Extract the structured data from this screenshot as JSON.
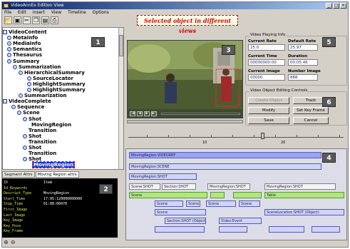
{
  "window": {
    "title": "VideoAnnEx Edition View",
    "controls": [
      "_",
      "□",
      "×"
    ]
  },
  "menu": [
    "File",
    "Edit",
    "Insert",
    "View",
    "Timeline",
    "Options"
  ],
  "toolbar": [
    "open-icon",
    "save-icon",
    "cut-icon",
    "copy-icon",
    "paste-icon",
    "print-icon"
  ],
  "banner": "Selected object in different views",
  "tree": [
    {
      "label": "VideoContent",
      "icon": "folder"
    },
    {
      "label": "MetaInfo",
      "icon": "node"
    },
    {
      "label": "MediaInfo",
      "icon": "node"
    },
    {
      "label": "Semantics",
      "icon": "node"
    },
    {
      "label": "Thesaurus",
      "icon": "node"
    },
    {
      "label": "Summary",
      "icon": "node"
    },
    {
      "label": "Summarization",
      "icon": "node"
    },
    {
      "label": "HierarchicalSummary",
      "icon": "node"
    },
    {
      "label": "SourceLocator",
      "icon": "node"
    },
    {
      "label": "HighlightSummary",
      "icon": "node"
    },
    {
      "label": "HighlightSummary",
      "icon": "node"
    },
    {
      "label": "Summarization",
      "icon": "node"
    },
    {
      "label": "VideoComplete",
      "icon": "folder"
    },
    {
      "label": "Sequence",
      "icon": "node"
    },
    {
      "label": "Scene",
      "icon": "node"
    },
    {
      "label": "Shot",
      "icon": "node"
    },
    {
      "label": "MovingRegion",
      "icon": "none"
    },
    {
      "label": "Transition",
      "icon": "none"
    },
    {
      "label": "Shot",
      "icon": "node"
    },
    {
      "label": "Transition",
      "icon": "none"
    },
    {
      "label": "Shot",
      "icon": "node"
    },
    {
      "label": "Transition",
      "icon": "none"
    },
    {
      "label": "Shot",
      "icon": "node"
    },
    {
      "label": "MovingRegion",
      "icon": "none",
      "selected": true
    }
  ],
  "tabs": [
    "Segment Attrs",
    "Moving Region attrs"
  ],
  "properties": [
    {
      "key": "ID",
      "value": "Item"
    },
    {
      "key": "Id_Keywords",
      "value": ""
    },
    {
      "key": "Descript_Type",
      "value": "MovingRegion"
    },
    {
      "key": "Start_Time",
      "value": "17:05:120000000000"
    },
    {
      "key": "Stop_Time",
      "value": "01:08:00470"
    },
    {
      "key": "First_Image",
      "value": ""
    },
    {
      "key": "Last_Image",
      "value": ""
    },
    {
      "key": "Key_Image",
      "value": ""
    },
    {
      "key": "Key_Pose",
      "value": ""
    },
    {
      "key": "Key_Frame",
      "value": ""
    }
  ],
  "badges": [
    "1",
    "2",
    "3",
    "4",
    "5",
    "6"
  ],
  "video_controls": [
    "|◀",
    "◀",
    "▶",
    "▶|"
  ],
  "playing_info": {
    "title": "Video Playing Info",
    "current_rate_label": "Current Rate",
    "current_rate": "25.0",
    "default_rate_label": "Default Rate",
    "default_rate": "25.97",
    "current_time_label": "Current Time",
    "current_time": "00000000:00",
    "duration_label": "Duration",
    "duration": "00:05:46",
    "current_image_label": "Current Image",
    "current_image": "00000",
    "number_image_label": "Number Image",
    "number_image": "888"
  },
  "editing": {
    "title": "Video Object Editing Controls",
    "buttons": [
      "Create Object",
      "Track",
      "Modify",
      "Set Key Frame",
      "Save",
      "Cancel"
    ],
    "disabled": [
      true,
      false,
      false,
      false,
      false,
      false
    ]
  },
  "ruler": {
    "labels": [
      "10",
      "20"
    ]
  },
  "timeline_bars": [
    {
      "label": "MovingRegion:VIDEOREF",
      "color": "blue"
    },
    {
      "label": "MovingRegion:SCENE",
      "color": "lav"
    },
    {
      "label": "MovingRegion:SHOT",
      "color": "lav"
    },
    {
      "label": "Scene:SHOT",
      "color": "white"
    },
    {
      "label": "Section:SHOT",
      "color": "white"
    },
    {
      "label": "MovingRegion:SHOT",
      "color": "white"
    },
    {
      "label": "MovingRegion:SHOT",
      "color": "white"
    },
    {
      "label": "Scene",
      "color": "green"
    },
    {
      "label": "",
      "color": "green"
    },
    {
      "label": "",
      "color": "green"
    },
    {
      "label": "Table",
      "color": "green"
    },
    {
      "label": "Scene",
      "color": "lav"
    },
    {
      "label": "Scene",
      "color": "lav"
    },
    {
      "label": "Scene",
      "color": "lav"
    },
    {
      "label": "Scene",
      "color": "lav"
    },
    {
      "label": "Scene",
      "color": "lav"
    },
    {
      "label": "SceneLocation:SHOT (Object)",
      "color": "lav"
    },
    {
      "label": "Section:SHOT (Object)",
      "color": "lav"
    },
    {
      "label": "Video:Event",
      "color": "lav"
    },
    {
      "label": "",
      "color": "lav"
    },
    {
      "label": "",
      "color": "lav"
    },
    {
      "label": "",
      "color": "lav"
    },
    {
      "label": "",
      "color": "lav"
    }
  ],
  "zoom": [
    "zoom-in-icon",
    "zoom-out-icon"
  ]
}
